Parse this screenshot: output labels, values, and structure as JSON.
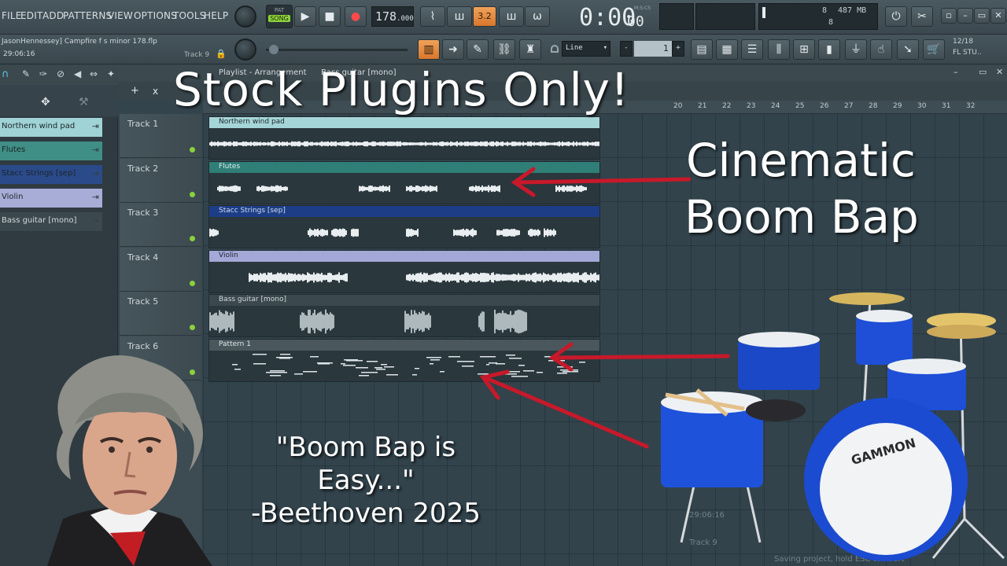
{
  "menu": {
    "items": [
      "FILE",
      "EDIT",
      "ADD",
      "PATTERNS",
      "VIEW",
      "OPTIONS",
      "TOOLS",
      "HELP"
    ]
  },
  "transport": {
    "pat_song_top": "PAT",
    "pat_song_active": "SONG",
    "tempo": "178",
    "tempo_decimal": ".000",
    "time": "0:00",
    "time_small": "00",
    "time_label": "M:S:CS",
    "step_label": "3.2",
    "memory": "487 MB",
    "cpu_num": "8",
    "voices": "8"
  },
  "project": {
    "title": "JasonHennessey] Campfire f s minor 178.flp",
    "time": "29:06:16",
    "hint_track": "Track 9"
  },
  "toolbar2": {
    "snap": "Line",
    "value": "1",
    "news_top": "12/18",
    "news_bottom": "FL STU.."
  },
  "playlist": {
    "title": "Playlist - Arrangement",
    "selected": "Bass guitar [mono]",
    "ruler": [
      "20",
      "21",
      "22",
      "23",
      "24",
      "25",
      "26",
      "27",
      "28",
      "29",
      "30",
      "31",
      "32"
    ]
  },
  "channels": [
    {
      "label": "Northern wind pad",
      "color": "#9fd3d6"
    },
    {
      "label": "Flutes",
      "color": "#3f8f86"
    },
    {
      "label": "Stacc Strings [sep]",
      "color": "#2a4a8a"
    },
    {
      "label": "Violin",
      "color": "#a8add8"
    },
    {
      "label": "Bass guitar [mono]",
      "color": "#3b484e"
    }
  ],
  "tracks": [
    {
      "label": "Track 1",
      "clip": "Northern wind pad",
      "color": "#a6d5d8",
      "text_color": "#1d2a2c"
    },
    {
      "label": "Track 2",
      "clip": "Flutes",
      "color": "#2f7e77",
      "text_color": "#d8efec"
    },
    {
      "label": "Track 3",
      "clip": "Stacc Strings [sep]",
      "color": "#1d3e86",
      "text_color": "#cfdaf2"
    },
    {
      "label": "Track 4",
      "clip": "Violin",
      "color": "#a3a8d6",
      "text_color": "#22253a"
    },
    {
      "label": "Track 5",
      "clip": "Bass guitar [mono]",
      "color": "#3b484e",
      "text_color": "#cfd8dc"
    },
    {
      "label": "Track 6",
      "clip": "Pattern 1",
      "color": "#4a575d",
      "text_color": "#dfe6e9"
    }
  ],
  "overlay": {
    "headline": "Stock Plugins Only!",
    "sub_line1": "Cinematic",
    "sub_line2": "Boom Bap",
    "quote_line1": "\"Boom Bap is",
    "quote_line2": "Easy...\"",
    "quote_line3": "-Beethoven 2025",
    "drum_brand": "GAMMON"
  },
  "status": {
    "time": "29:06:16",
    "track": "Track 9",
    "saving": "Saving project, hold ESC to abort"
  },
  "colors": {
    "accent_orange": "#e88b3c",
    "arrow_red": "#c8192a",
    "led_green": "#8ad23c",
    "drum_blue": "#1e4fd6"
  }
}
